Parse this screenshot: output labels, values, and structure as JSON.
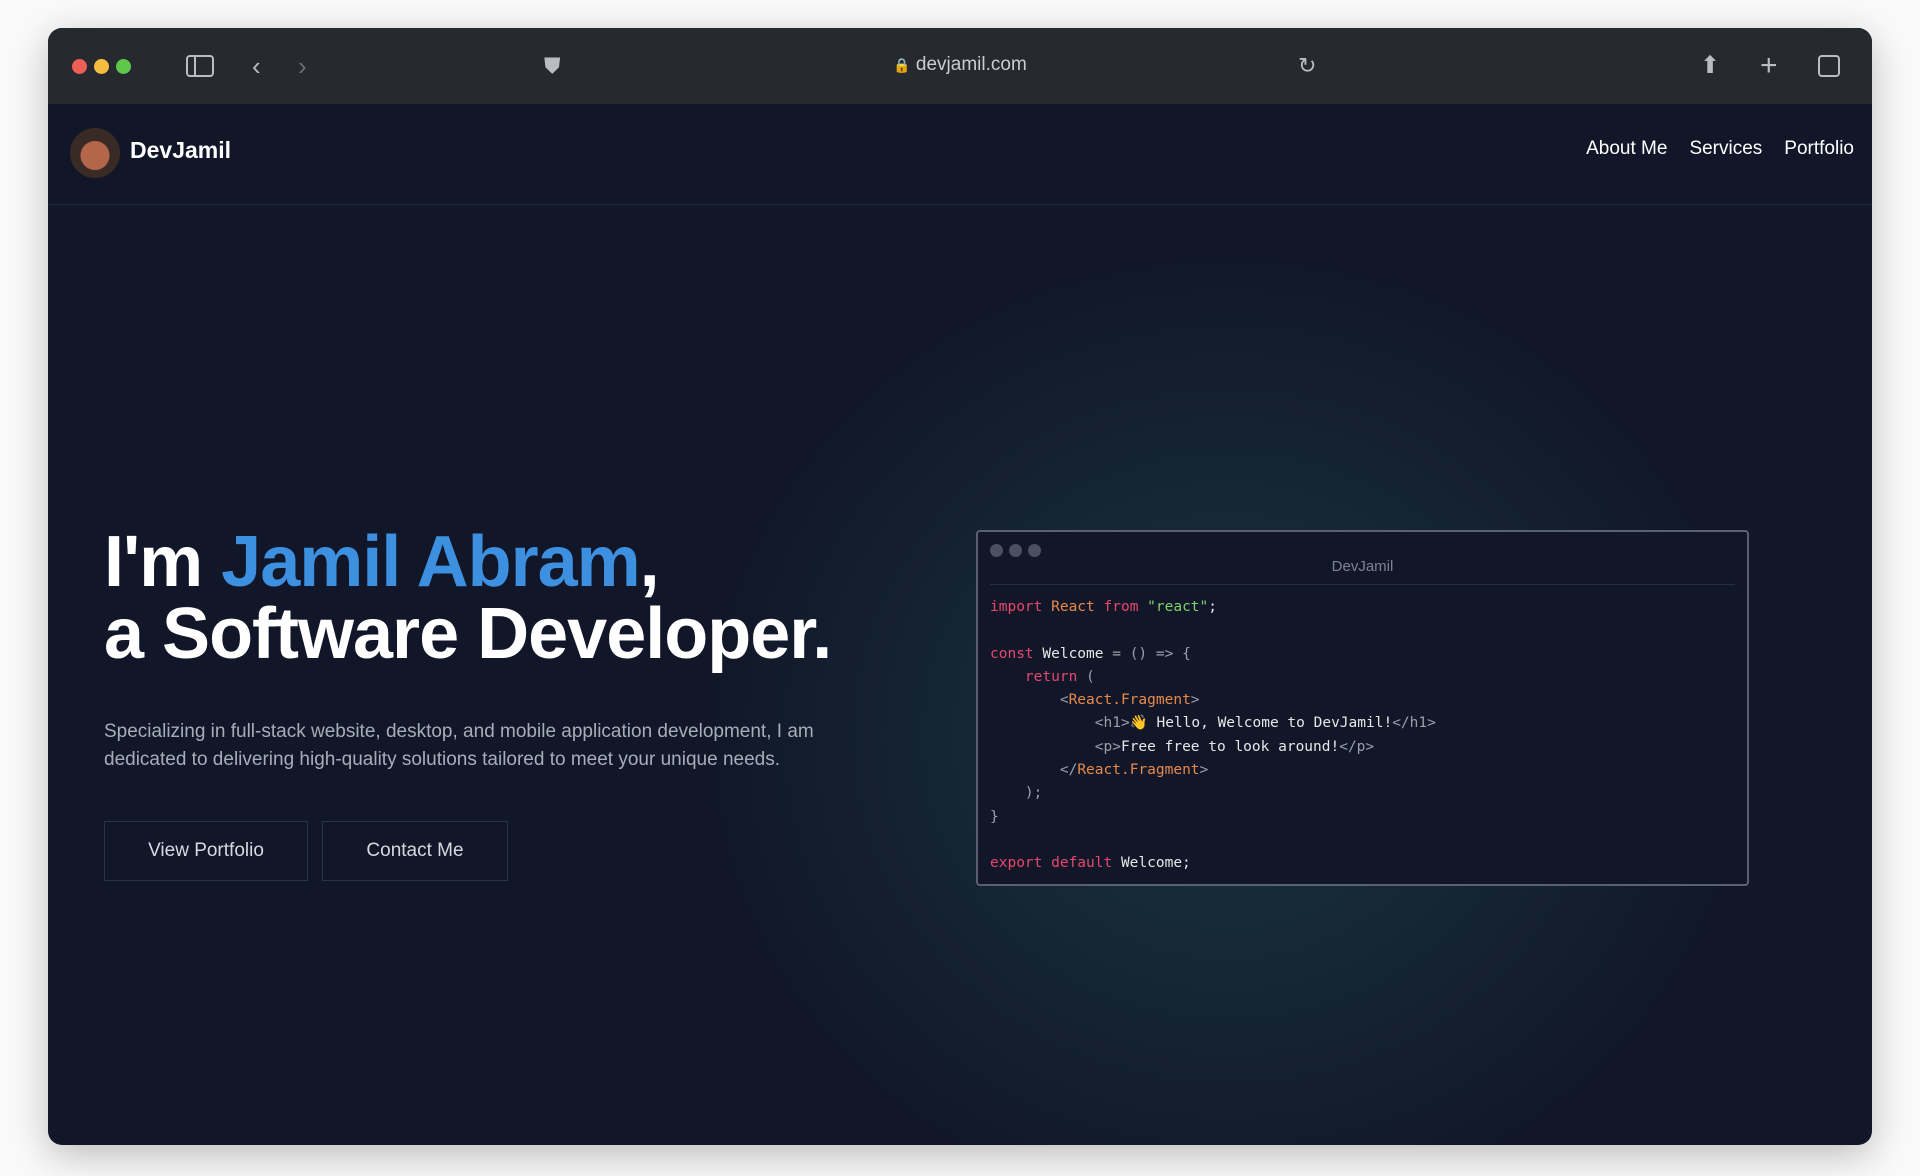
{
  "browser": {
    "url": "devjamil.com"
  },
  "nav": {
    "brand": "DevJamil",
    "links": [
      "About Me",
      "Services",
      "Portfolio"
    ]
  },
  "hero": {
    "prefix": "I'm ",
    "name": "Jamil Abram",
    "comma": ",",
    "line2": "a Software Developer.",
    "description": "Specializing in full-stack website, desktop, and mobile application development, I am dedicated to delivering high-quality solutions tailored to meet your unique needs.",
    "buttons": [
      "View Portfolio",
      "Contact Me"
    ]
  },
  "code_window": {
    "title": "DevJamil",
    "lines": [
      [
        [
          "k",
          "import "
        ],
        [
          "o",
          "React "
        ],
        [
          "k",
          "from "
        ],
        [
          "s",
          "\"react\""
        ],
        [
          "t",
          ";"
        ]
      ],
      [],
      [
        [
          "k",
          "const "
        ],
        [
          "t",
          "Welcome "
        ],
        [
          "g",
          "= () => {"
        ]
      ],
      [
        [
          "t",
          "    "
        ],
        [
          "k",
          "return "
        ],
        [
          "g",
          "("
        ]
      ],
      [
        [
          "t",
          "        "
        ],
        [
          "g",
          "<"
        ],
        [
          "o",
          "React.Fragment"
        ],
        [
          "g",
          ">"
        ]
      ],
      [
        [
          "t",
          "            "
        ],
        [
          "g",
          "<h1>"
        ],
        [
          "t",
          "👋 Hello, Welcome to DevJamil!"
        ],
        [
          "g",
          "</h1>"
        ]
      ],
      [
        [
          "t",
          "            "
        ],
        [
          "g",
          "<p>"
        ],
        [
          "t",
          "Free free to look around!"
        ],
        [
          "g",
          "</p>"
        ]
      ],
      [
        [
          "t",
          "        "
        ],
        [
          "g",
          "</"
        ],
        [
          "o",
          "React.Fragment"
        ],
        [
          "g",
          ">"
        ]
      ],
      [
        [
          "t",
          "    "
        ],
        [
          "g",
          ");"
        ]
      ],
      [
        [
          "g",
          "}"
        ]
      ],
      [],
      [
        [
          "k",
          "export "
        ],
        [
          "k",
          "default "
        ],
        [
          "t",
          "Welcome;"
        ]
      ]
    ]
  },
  "colors": {
    "accent": "#3d8fe0",
    "background": "#111729",
    "keyword": "#e8476d",
    "identifier": "#e8894a",
    "string": "#7ed26a"
  }
}
